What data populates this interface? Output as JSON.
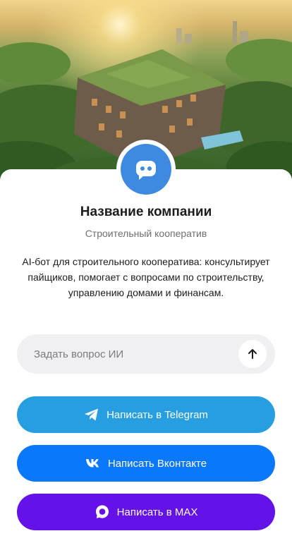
{
  "header": {
    "cover_image": "residential-complex-photo",
    "avatar_icon": "chat-bot-icon",
    "avatar_color": "#3d8ae0"
  },
  "company": {
    "name": "Название компании",
    "type": "Строительный кооператив",
    "description": "AI-бот для строительного кооператива: консультирует пайщиков, помогает с вопросами по строительству, управлению домами и финансам."
  },
  "ask": {
    "placeholder": "Задать вопрос ИИ",
    "value": "",
    "send_icon": "arrow-up-icon"
  },
  "buttons": {
    "telegram": {
      "label": "Написать в Telegram",
      "icon": "telegram-icon",
      "color": "#279ee0"
    },
    "vk": {
      "label": "Написать Вконтакте",
      "icon": "vk-icon",
      "color": "#0a78fb"
    },
    "max": {
      "label": "Написать в MAX",
      "icon": "max-icon",
      "color": "#6512e8"
    }
  }
}
